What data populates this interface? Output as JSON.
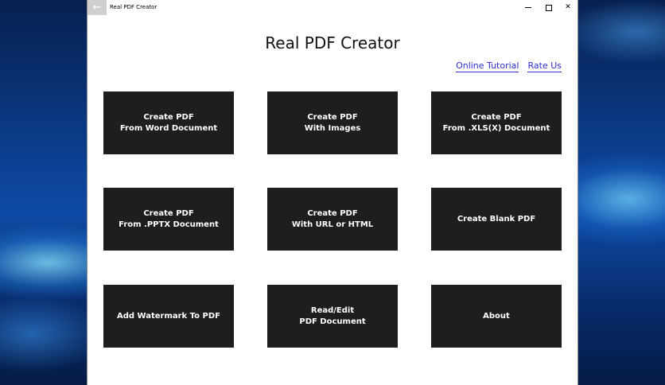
{
  "window": {
    "title": "Real PDF Creator",
    "back_icon": "←",
    "close_icon": "✕"
  },
  "main": {
    "heading": "Real PDF Creator",
    "links": {
      "tutorial": "Online Tutorial",
      "rate": "Rate Us",
      "color": "#2d2dd0"
    }
  },
  "tiles": {
    "word": {
      "line1": "Create PDF",
      "line2": "From Word Document"
    },
    "images": {
      "line1": "Create PDF",
      "line2": "With Images"
    },
    "xls": {
      "line1": "Create PDF",
      "line2": "From .XLS(X) Document"
    },
    "pptx": {
      "line1": "Create PDF",
      "line2": "From .PPTX Document"
    },
    "url": {
      "line1": "Create PDF",
      "line2": "With URL or HTML"
    },
    "blank": {
      "line1": "Create Blank PDF"
    },
    "watermark": {
      "line1": "Add Watermark To PDF"
    },
    "read_edit": {
      "line1": "Read/Edit",
      "line2": "PDF Document"
    },
    "about": {
      "line1": "About"
    }
  },
  "colors": {
    "tile_bg": "#1e1e1e",
    "tile_text": "#ffffff",
    "window_bg": "#ffffff"
  }
}
